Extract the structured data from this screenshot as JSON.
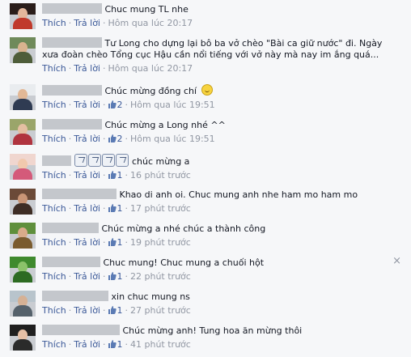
{
  "labels": {
    "like": "Thích",
    "reply": "Trả lời"
  },
  "colors": {
    "link": "#3b5998",
    "meta": "#9197a3",
    "background": "#f6f7f9"
  },
  "close_icon": "×",
  "comments": [
    {
      "text": "Chuc mung TL nhe",
      "likes": "",
      "time": "Hôm qua lúc 20:17"
    },
    {
      "text": "Tư Long cho dựng lại bô ba vở chèo \"Bài ca giữ nước\" đi. Ngày",
      "text2": "xưa đoàn chèo Tổng cục Hậu cần nổi tiếng với vở này mà nay im ắng quá...",
      "likes": "",
      "time": "Hôm qua lúc 20:17"
    },
    {
      "text": "Chúc mừng đồng chí",
      "likes": "2",
      "time": "Hôm qua lúc 19:51"
    },
    {
      "text": "Chúc mừng a Long nhé ^^",
      "likes": "2",
      "time": "Hôm qua lúc 19:51"
    },
    {
      "text": "chúc mừng a",
      "likes": "1",
      "time": "16 phút trước"
    },
    {
      "text": "Khao di anh oi. Chuc mung anh nhe ham mo ham mo",
      "likes": "1",
      "time": "17 phút trước"
    },
    {
      "text": "Chúc mừng a nhé chúc a thành công",
      "likes": "1",
      "time": "19 phút trước"
    },
    {
      "text": "Chuc mung! Chuc mung a chuối hột",
      "likes": "1",
      "time": "22 phút trước"
    },
    {
      "text": "xin chuc mung ns",
      "likes": "1",
      "time": "27 phút trước"
    },
    {
      "text": "Chúc mừng anh! Tung hoa ăn mừng thôi",
      "likes": "1",
      "time": "41 phút trước"
    }
  ]
}
